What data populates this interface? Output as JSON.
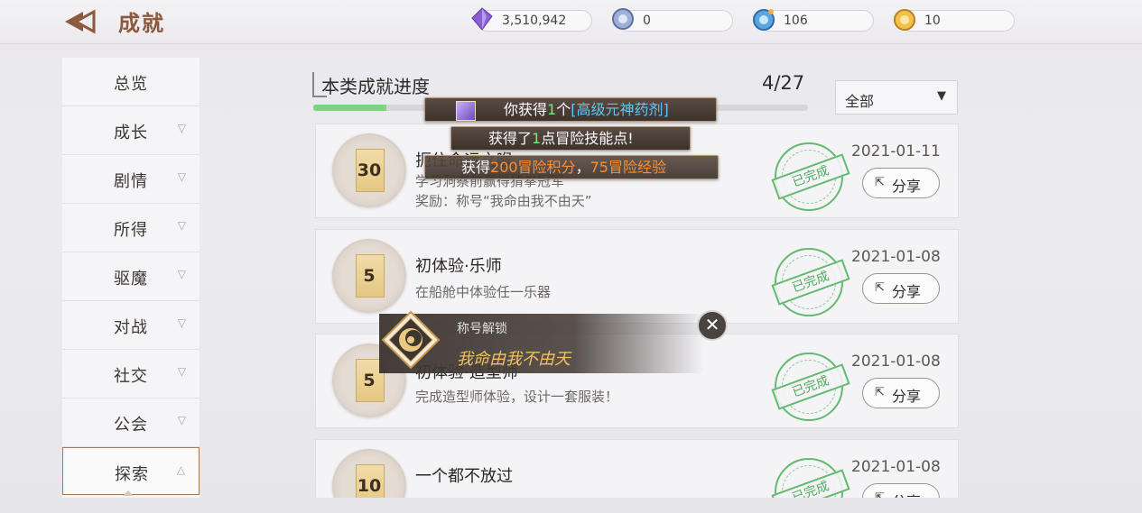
{
  "header": {
    "title": "成就",
    "currencies": [
      {
        "icon": "purple-crystal-icon",
        "value": "3,510,942"
      },
      {
        "icon": "blue-orb-icon",
        "value": "0"
      },
      {
        "icon": "blue-coin-icon",
        "value": "106"
      },
      {
        "icon": "gold-coin-icon",
        "value": "10"
      }
    ]
  },
  "sidebar": {
    "items": [
      {
        "label": "总览"
      },
      {
        "label": "成长"
      },
      {
        "label": "剧情"
      },
      {
        "label": "所得"
      },
      {
        "label": "驱魔"
      },
      {
        "label": "对战"
      },
      {
        "label": "社交"
      },
      {
        "label": "公会"
      },
      {
        "label": "探索"
      }
    ],
    "active": "探索"
  },
  "progress": {
    "title": "本类成就进度",
    "count": "4/27",
    "fraction": 0.148
  },
  "filter": {
    "value": "全部"
  },
  "achievements": [
    {
      "points": "30",
      "name": "扼住命运之喉",
      "desc": "学习洞察前赢得猜拳冠军",
      "reward": "奖励：称号“我命由我不由天”",
      "status": "已完成",
      "date": "2021-01-11",
      "share": "分享"
    },
    {
      "points": "5",
      "name": "初体验·乐师",
      "desc": "在船舱中体验任一乐器",
      "reward": "",
      "status": "已完成",
      "date": "2021-01-08",
      "share": "分享"
    },
    {
      "points": "5",
      "name": "初体验·造型师",
      "desc": "完成造型师体验，设计一套服装！",
      "reward": "",
      "status": "已完成",
      "date": "2021-01-08",
      "share": "分享"
    },
    {
      "points": "10",
      "name": "一个都不放过",
      "desc": "",
      "reward": "",
      "status": "已完成",
      "date": "2021-01-08",
      "share": "分享"
    }
  ],
  "toasts": {
    "t1": {
      "a": "你获得",
      "b": "1",
      "c": "个",
      "d": "[高级元神药剂]"
    },
    "t2": {
      "a": "获得了",
      "b": "1",
      "c": "点冒险技能点!"
    },
    "t3": {
      "a": "获得",
      "b": "200冒险积分",
      "c": "，",
      "d": "75冒险经验"
    }
  },
  "title_unlock": {
    "heading": "称号解锁",
    "title": "我命由我不由天"
  }
}
